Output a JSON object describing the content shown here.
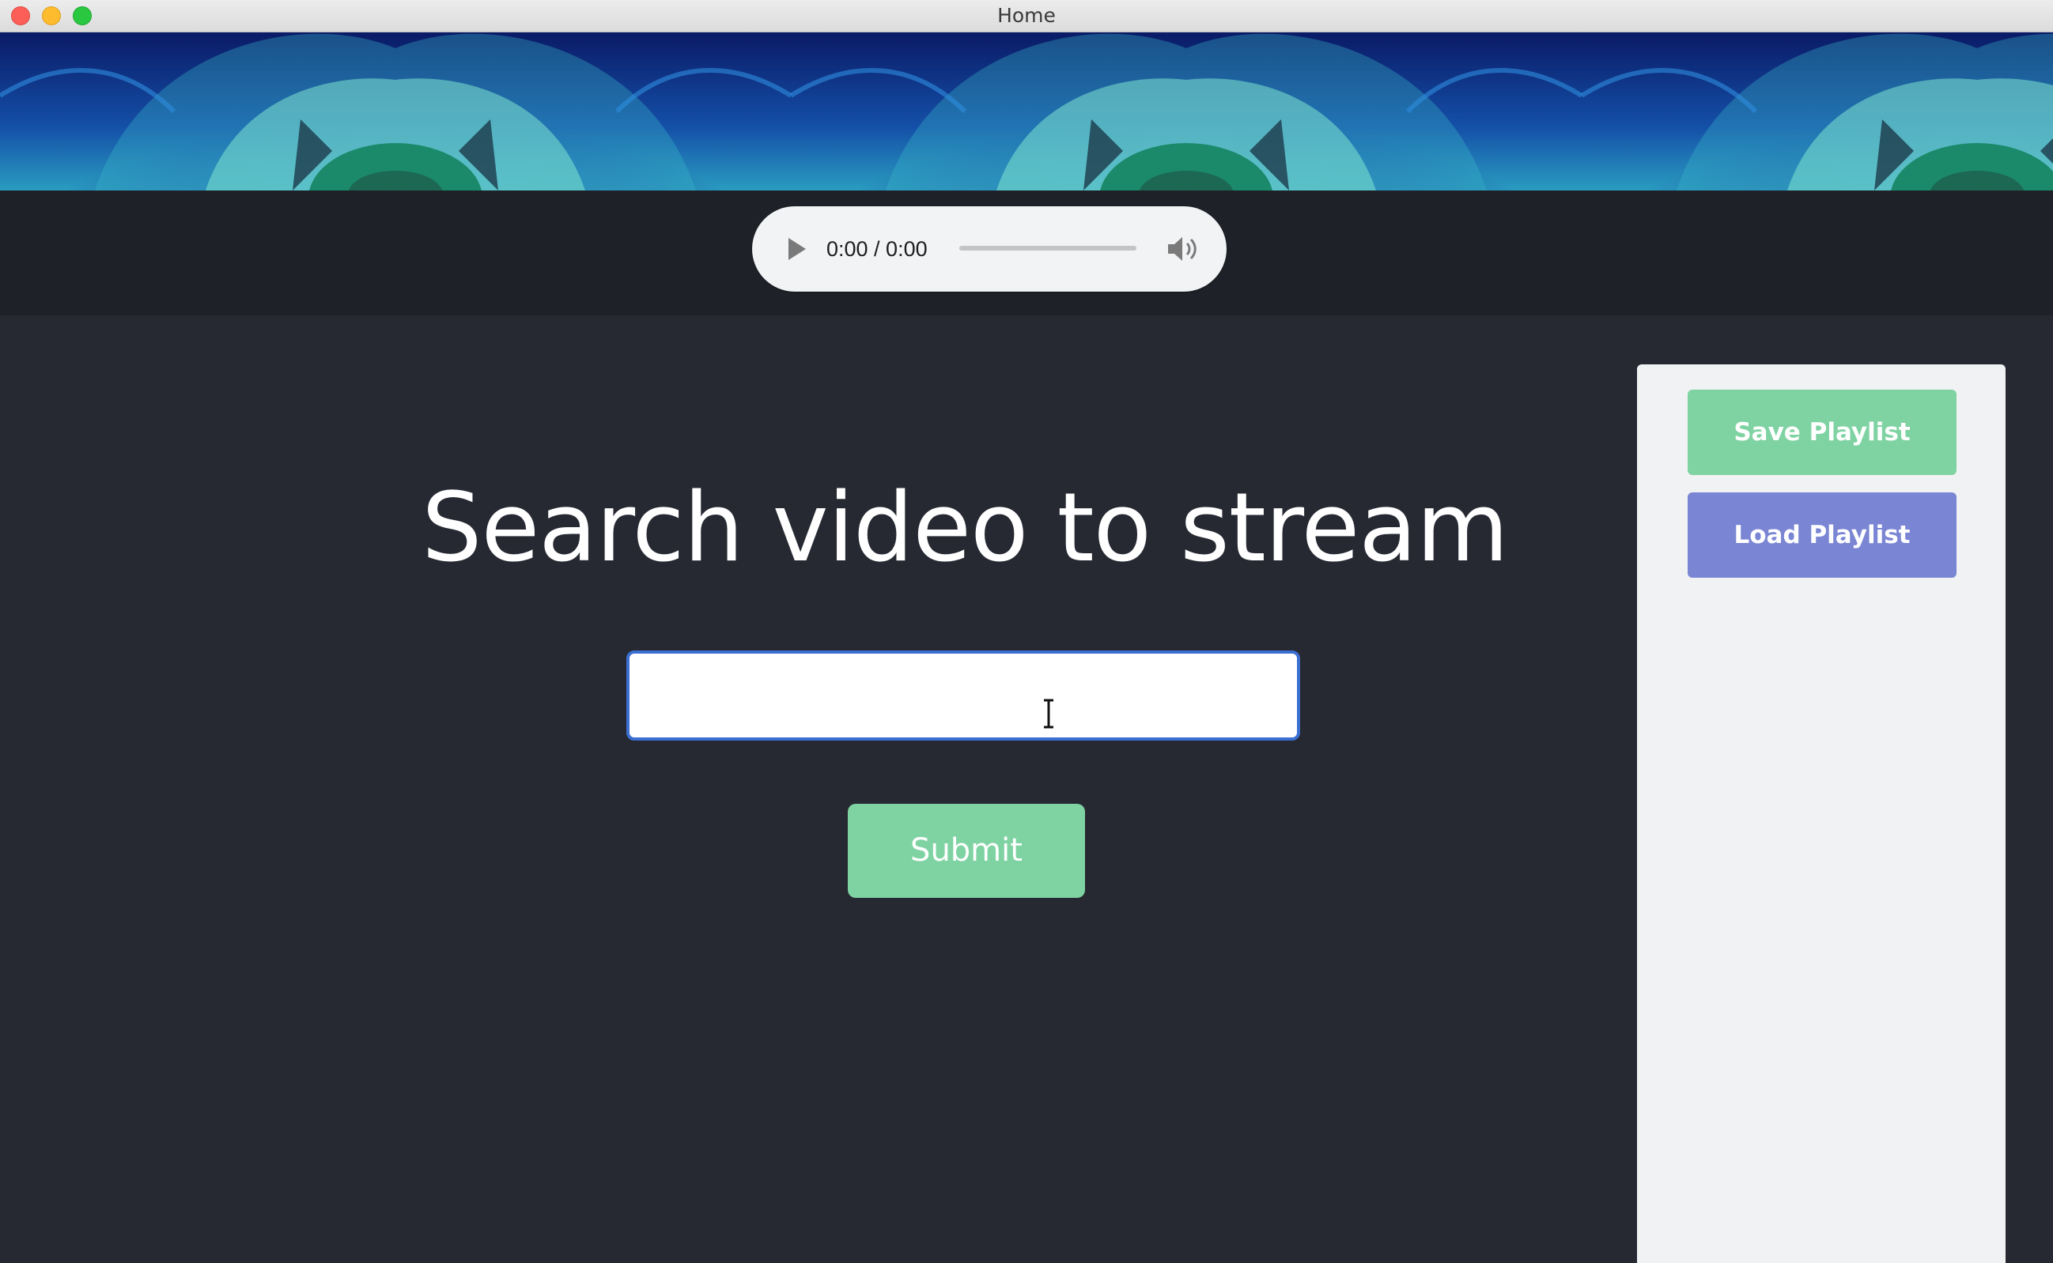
{
  "window": {
    "title": "Home"
  },
  "audio_player": {
    "time": "0:00 / 0:00",
    "progress": 0,
    "play_icon": "play-icon",
    "volume_icon": "volume-icon"
  },
  "main": {
    "heading": "Search video to stream",
    "search_value": "",
    "search_placeholder": "",
    "submit_label": "Submit"
  },
  "sidebar": {
    "save_label": "Save Playlist",
    "load_label": "Load Playlist"
  },
  "colors": {
    "background": "#262932",
    "player_strip": "#1f2128",
    "green_button": "#7fd3a3",
    "blue_button": "#7a86d4",
    "sidebar": "#f1f2f4",
    "input_focus_border": "#3b6fd1"
  }
}
